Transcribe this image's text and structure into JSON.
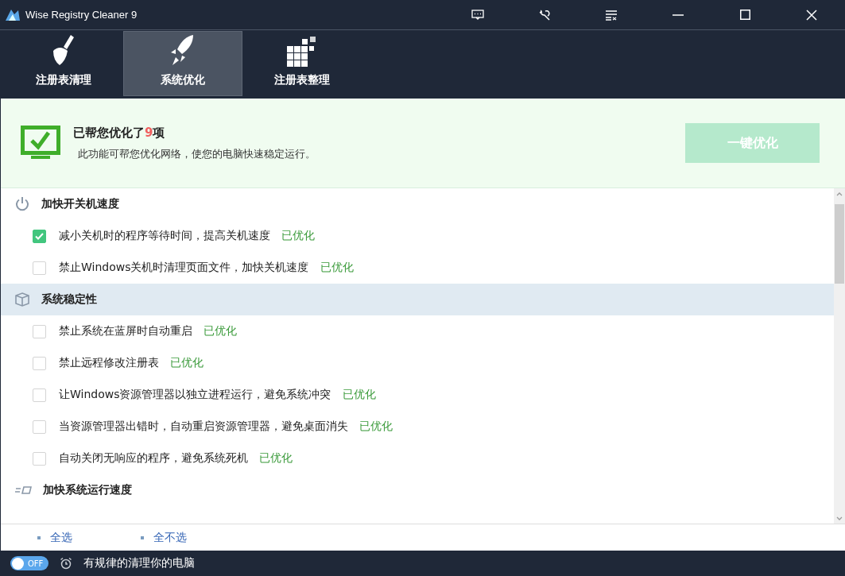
{
  "window": {
    "title": "Wise Registry Cleaner 9"
  },
  "tabs": [
    {
      "label": "注册表清理",
      "kind": "broom",
      "selected": false
    },
    {
      "label": "系统优化",
      "kind": "rocket",
      "selected": true
    },
    {
      "label": "注册表整理",
      "kind": "blocks",
      "selected": false
    }
  ],
  "summary": {
    "title": "已帮您优化了**9**项",
    "description": "此功能可帮您优化网络，使您的电脑快速稳定运行。",
    "button": {
      "label": "一键优化",
      "disabled": true
    }
  },
  "sections": [
    {
      "title": "加快开关机速度",
      "kind": "power",
      "selected": false,
      "items": [
        {
          "label": "减小关机时的程序等待时间，提高关机速度",
          "status": "已优化",
          "checked": true
        },
        {
          "label": "禁止Windows关机时清理页面文件，加快关机速度",
          "status": "已优化",
          "checked": false
        }
      ]
    },
    {
      "title": "系统稳定性",
      "kind": "cube",
      "selected": true,
      "items": [
        {
          "label": "禁止系统在蓝屏时自动重启",
          "status": "已优化",
          "checked": false
        },
        {
          "label": "禁止远程修改注册表",
          "status": "已优化",
          "checked": false
        },
        {
          "label": "让Windows资源管理器以独立进程运行，避免系统冲突",
          "status": "已优化",
          "checked": false
        },
        {
          "label": "当资源管理器出错时，自动重启资源管理器，避免桌面消失",
          "status": "已优化",
          "checked": false
        },
        {
          "label": "自动关闭无响应的程序，避免系统死机",
          "status": "已优化",
          "checked": false
        }
      ]
    },
    {
      "title": "加快系统运行速度",
      "kind": "speed",
      "selected": false
    }
  ],
  "footer_links": [
    "全选",
    "全不选"
  ],
  "status_bar": {
    "toggle": {
      "label": "OFF",
      "on": false
    },
    "text": "有规律的清理你的电脑"
  }
}
